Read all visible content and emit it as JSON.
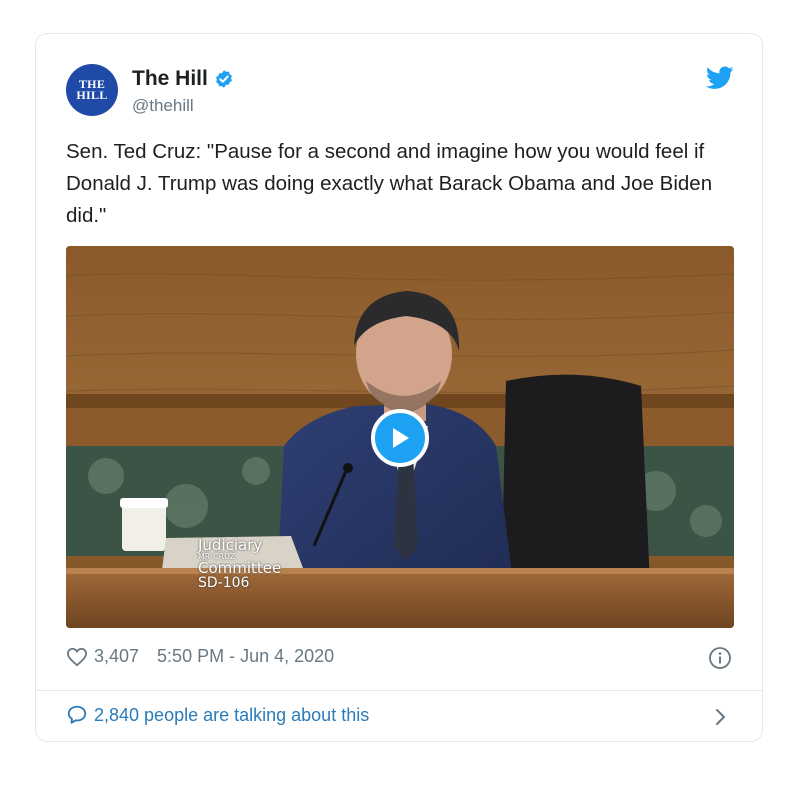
{
  "account": {
    "avatar_text": [
      "THE",
      "HILL"
    ],
    "display_name": "The Hill",
    "handle": "@thehill",
    "verified": true
  },
  "tweet": {
    "text": "Sen. Ted Cruz: \"Pause for a second and imagine how you would feel if Donald J. Trump was doing exactly what Barack Obama and Joe Biden did.\""
  },
  "media": {
    "type": "video",
    "placard_lines": [
      "Judiciary",
      "MR CRUZ",
      "Committee",
      "SD-106"
    ]
  },
  "meta": {
    "likes": "3,407",
    "timestamp": "5:50 PM - Jun 4, 2020"
  },
  "conversation": {
    "label": "2,840 people are talking about this"
  },
  "colors": {
    "accent": "#1da1f2",
    "link": "#2b7bb9",
    "muted": "#697882",
    "border": "#e1e8ed"
  }
}
